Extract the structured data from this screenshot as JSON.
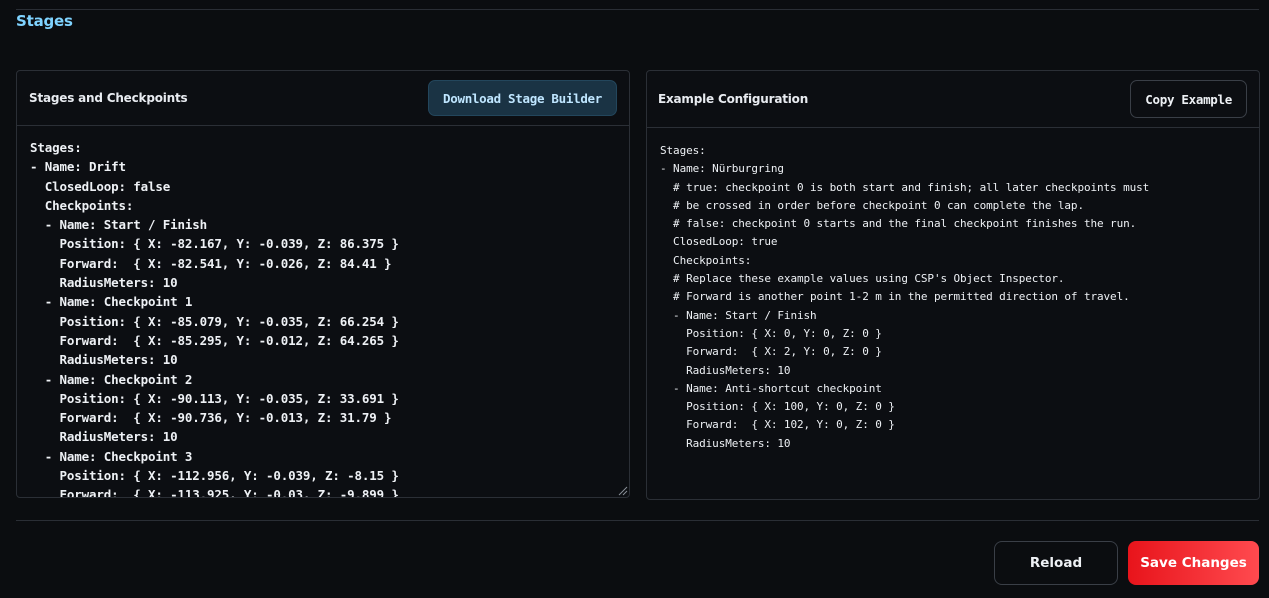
{
  "section": {
    "title": "Stages"
  },
  "left_panel": {
    "title": "Stages and Checkpoints",
    "download_button": "Download Stage Builder",
    "editor_text": "Stages:\n- Name: Drift\n  ClosedLoop: false\n  Checkpoints:\n  - Name: Start / Finish\n    Position: { X: -82.167, Y: -0.039, Z: 86.375 }\n    Forward:  { X: -82.541, Y: -0.026, Z: 84.41 }\n    RadiusMeters: 10\n  - Name: Checkpoint 1\n    Position: { X: -85.079, Y: -0.035, Z: 66.254 }\n    Forward:  { X: -85.295, Y: -0.012, Z: 64.265 }\n    RadiusMeters: 10\n  - Name: Checkpoint 2\n    Position: { X: -90.113, Y: -0.035, Z: 33.691 }\n    Forward:  { X: -90.736, Y: -0.013, Z: 31.79 }\n    RadiusMeters: 10\n  - Name: Checkpoint 3\n    Position: { X: -112.956, Y: -0.039, Z: -8.15 }\n    Forward:  { X: -113.925, Y: -0.03, Z: -9.899 }"
  },
  "right_panel": {
    "title": "Example Configuration",
    "copy_button": "Copy Example",
    "example_text": "Stages:\n- Name: Nürburgring\n  # true: checkpoint 0 is both start and finish; all later checkpoints must\n  # be crossed in order before checkpoint 0 can complete the lap.\n  # false: checkpoint 0 starts and the final checkpoint finishes the run.\n  ClosedLoop: true\n  Checkpoints:\n  # Replace these example values using CSP's Object Inspector.\n  # Forward is another point 1-2 m in the permitted direction of travel.\n  - Name: Start / Finish\n    Position: { X: 0, Y: 0, Z: 0 }\n    Forward:  { X: 2, Y: 0, Z: 0 }\n    RadiusMeters: 10\n  - Name: Anti-shortcut checkpoint\n    Position: { X: 100, Y: 0, Z: 0 }\n    Forward:  { X: 102, Y: 0, Z: 0 }\n    RadiusMeters: 10"
  },
  "footer": {
    "reload_label": "Reload",
    "save_label": "Save Changes"
  },
  "colors": {
    "accent": "#7fd3ff",
    "danger": "#e8141b",
    "background": "#0b0d10"
  }
}
